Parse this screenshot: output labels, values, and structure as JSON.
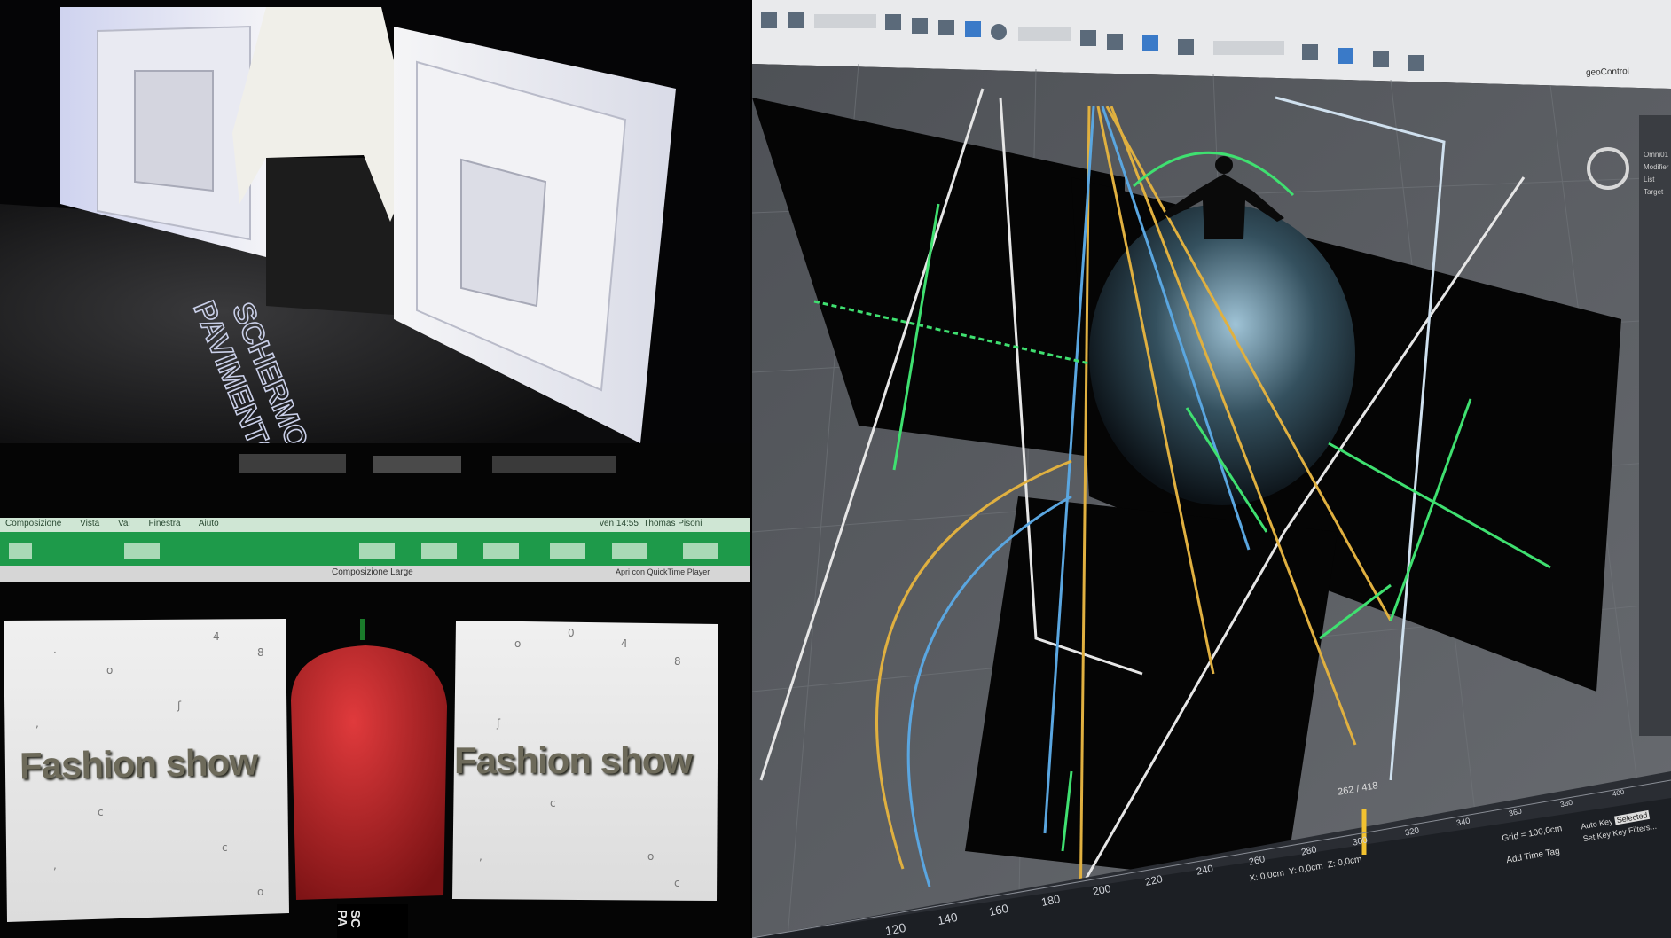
{
  "projection_panel": {
    "floor_label_line1": "SCHERMO",
    "floor_label_line2": "PAVIMENTO"
  },
  "mac_panel": {
    "menu": [
      "Composizione",
      "Vista",
      "Vai",
      "Finestra",
      "Aiuto"
    ],
    "clock": "ven 14:55",
    "user": "Thomas Pisoni",
    "window_title": "Composizione Large",
    "window_status": "Apri con QuickTime Player",
    "screen_left_text": "Fashion show",
    "screen_right_text": "Fashion show",
    "bottom_label_line1": "SC",
    "bottom_label_line2": "PA"
  },
  "max_panel": {
    "top_right_tabs": "geoControl",
    "frame_counter": "262 / 418",
    "timeline_ticks": [
      "120",
      "140",
      "160",
      "180",
      "200",
      "220",
      "240",
      "260",
      "280",
      "300",
      "320",
      "340",
      "360",
      "380",
      "400"
    ],
    "coord_x": "0,0cm",
    "coord_y": "0,0cm",
    "coord_z": "0,0cm",
    "grid": "Grid = 100,0cm",
    "add_time_tag": "Add Time Tag",
    "auto_key": "Auto Key",
    "set_key": "Set Key",
    "key_filters": "Key Filters...",
    "selected": "Selected",
    "side_labels": [
      "Omni01",
      "Modifier List",
      "Target"
    ]
  },
  "colors": {
    "viewport_bg": "#5a5d62",
    "mac_bar": "#1e9a4a",
    "candle_red": "#c8262a",
    "cam_yellow": "#e0b040",
    "cam_blue": "#5aa6e0",
    "helper_green": "#3fe070"
  }
}
